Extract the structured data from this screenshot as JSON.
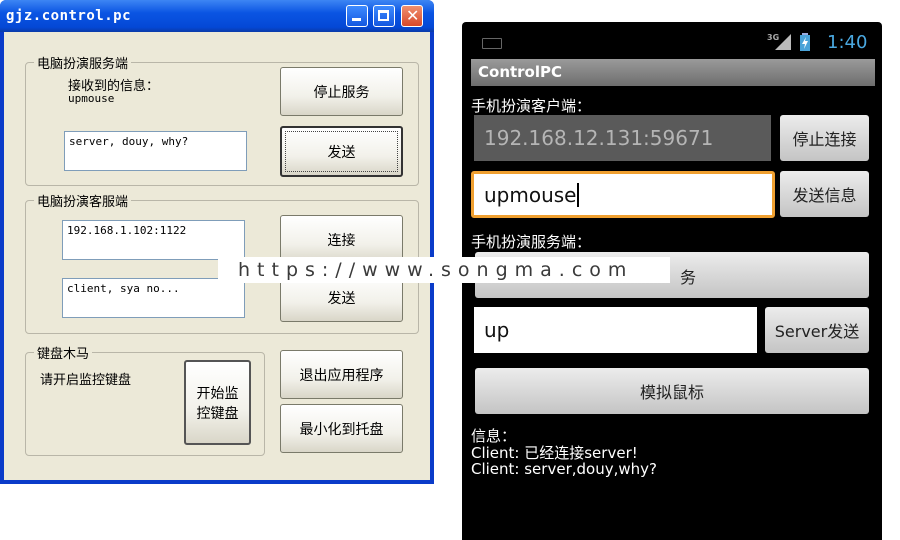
{
  "pc_window": {
    "title": "gjz.control.pc",
    "server_group": {
      "label": "电脑扮演服务端",
      "received_label": "接收到的信息：",
      "received_value": "upmouse",
      "message_field_value": "server, douy, why?",
      "stop_button": "停止服务",
      "send_button": "发送"
    },
    "client_group": {
      "label": "电脑扮演客服端",
      "address_value": "192.168.1.102:1122",
      "message_field_value": "client, sya no...",
      "connect_button": "连接",
      "send_button": "发送"
    },
    "keyboard_group": {
      "label": "键盘木马",
      "hint": "请开启监控键盘",
      "start_button_line1": "开始监",
      "start_button_line2": "控键盘"
    },
    "exit_button": "退出应用程序",
    "minimize_tray_button": "最小化到托盘"
  },
  "phone": {
    "status_bar": {
      "network": "3G",
      "time": "1:40"
    },
    "app_title": "ControlPC",
    "client_section_label": "手机扮演客户端：",
    "address_value": "192.168.12.131:59671",
    "stop_connect_button": "停止连接",
    "message_value": "upmouse",
    "send_message_button": "发送信息",
    "server_section_label": "手机扮演服务端：",
    "service_button": "务",
    "server_message_value": "up",
    "server_send_button": "Server发送",
    "simulate_mouse_button": "模拟鼠标",
    "info_label": "信息：",
    "info_lines": [
      "Client: 已经连接server!",
      "Client: server,douy,why?"
    ]
  },
  "watermark": "https://www.songma.com",
  "colors": {
    "xp_title": "#0b55e3",
    "xp_face": "#ece9d8",
    "android_focus": "#f0a030"
  }
}
